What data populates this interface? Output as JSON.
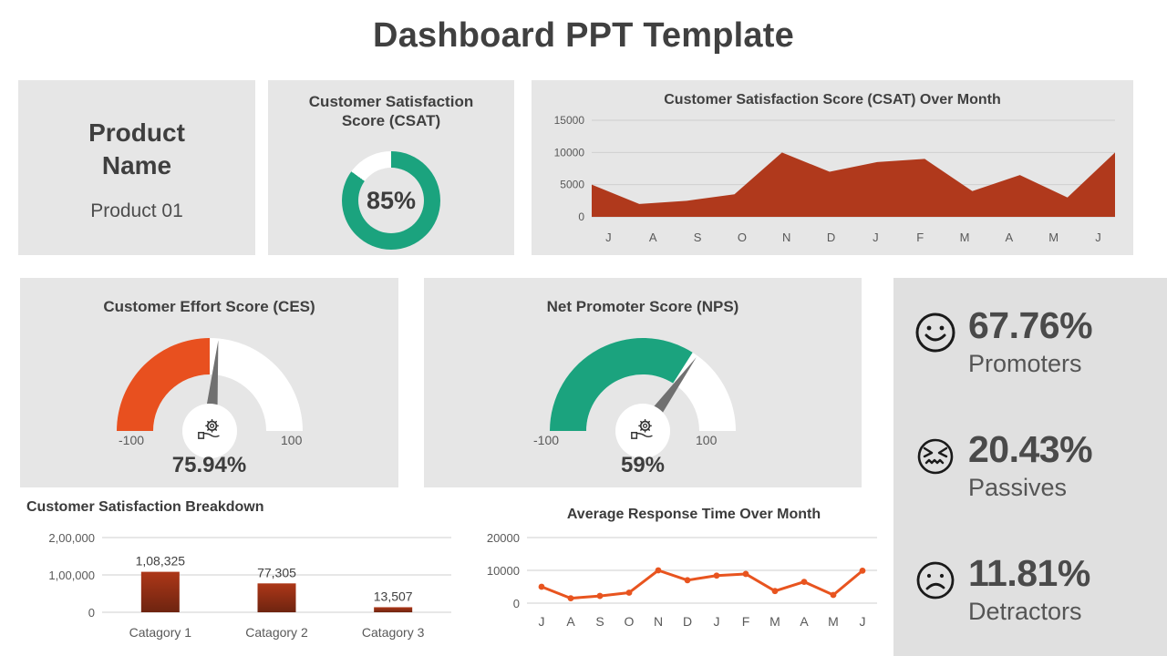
{
  "page": {
    "title": "Dashboard PPT Template"
  },
  "colors": {
    "card_bg": "#e6e6e6",
    "panel_bg": "#e0e0e0",
    "teal": "#1ba37e",
    "orange": "#e8501f",
    "brick": "#b0391c",
    "dark_red": "#7a2910",
    "text_dark": "#404040",
    "text_gray": "#595959",
    "needle": "#707070"
  },
  "product": {
    "name": "Product\nName",
    "name_line1": "Product",
    "name_line2": "Name",
    "subtitle": "Product 01"
  },
  "csat_donut": {
    "title_line1": "Customer Satisfaction",
    "title_line2": "Score (CSAT)",
    "value_label": "85%",
    "value": 85,
    "fill_color": "#1ba37e",
    "track_color": "#ffffff"
  },
  "ces_gauge": {
    "title": "Customer Effort Score (CES)",
    "value_label": "75.94%",
    "value": 75.94,
    "min_label": "-100",
    "max_label": "100",
    "arc_fraction": 0.5,
    "needle_fraction": 0.53,
    "fill_color": "#e8501f",
    "track_color": "#ffffff",
    "center_icon": "hand-holding-gear-icon"
  },
  "nps_gauge": {
    "title": "Net Promoter Score (NPS)",
    "value_label": "59%",
    "value": 59,
    "min_label": "-100",
    "max_label": "100",
    "arc_fraction": 0.68,
    "needle_fraction": 0.7,
    "fill_color": "#1ba37e",
    "track_color": "#ffffff",
    "center_icon": "hand-holding-gear-icon"
  },
  "nps_breakdown": {
    "rows": [
      {
        "icon": "smiley-face-icon",
        "percent": "67.76%",
        "label": "Promoters"
      },
      {
        "icon": "grimace-face-icon",
        "percent": "20.43%",
        "label": "Passives"
      },
      {
        "icon": "frowning-face-icon",
        "percent": "11.81%",
        "label": "Detractors"
      }
    ]
  },
  "chart_data": [
    {
      "id": "csat_over_month",
      "type": "area",
      "title": "Customer Satisfaction Score (CSAT) Over Month",
      "xlabel": "",
      "ylabel": "",
      "categories": [
        "J",
        "A",
        "S",
        "O",
        "N",
        "D",
        "J",
        "F",
        "M",
        "A",
        "M",
        "J"
      ],
      "values": [
        5000,
        2000,
        2500,
        3500,
        10000,
        7000,
        8500,
        9000,
        4000,
        6500,
        3000,
        10000
      ],
      "ytick_labels": [
        "0",
        "5000",
        "10000",
        "15000"
      ],
      "yticks": [
        0,
        5000,
        10000,
        15000
      ],
      "ylim": [
        0,
        15000
      ],
      "grid": true,
      "legend": "none",
      "series_color": "#b0391c"
    },
    {
      "id": "csat_breakdown",
      "type": "bar",
      "title": "Customer Satisfaction Breakdown",
      "xlabel": "",
      "ylabel": "",
      "categories": [
        "Catagory 1",
        "Catagory 2",
        "Catagory 3"
      ],
      "values": [
        108325,
        77305,
        13507
      ],
      "data_labels": [
        "1,08,325",
        "77,305",
        "13,507"
      ],
      "ytick_labels": [
        "0",
        "1,00,000",
        "2,00,000"
      ],
      "yticks": [
        0,
        100000,
        200000
      ],
      "ylim": [
        0,
        200000
      ],
      "grid": true,
      "legend": "none",
      "series_color": "#a8361a"
    },
    {
      "id": "avg_response_time",
      "type": "line",
      "title": "Average Response Time Over Month",
      "xlabel": "",
      "ylabel": "",
      "categories": [
        "J",
        "A",
        "S",
        "O",
        "N",
        "D",
        "J",
        "F",
        "M",
        "A",
        "M",
        "J"
      ],
      "values": [
        5000,
        1500,
        2200,
        3200,
        10000,
        7000,
        8400,
        8900,
        3700,
        6500,
        2500,
        9900
      ],
      "ytick_labels": [
        "0",
        "10000",
        "20000"
      ],
      "yticks": [
        0,
        10000,
        20000
      ],
      "ylim": [
        0,
        20000
      ],
      "grid": true,
      "legend": "none",
      "series_color": "#e8541f",
      "markers": true
    }
  ]
}
